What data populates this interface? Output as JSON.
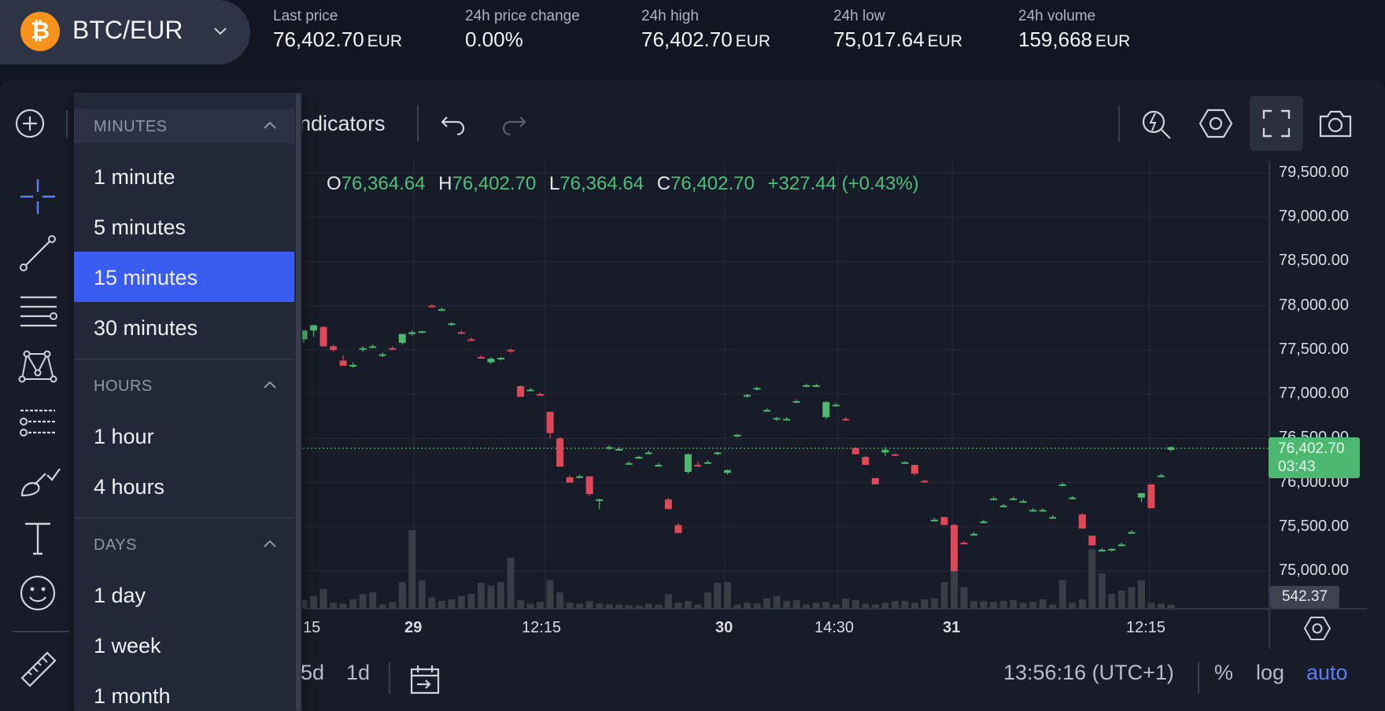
{
  "market": {
    "pair": "BTC/EUR",
    "coin_icon": "bitcoin-icon",
    "currency": "EUR",
    "last_price_label": "Last price",
    "last_price": "76,402.70",
    "change_label": "24h price change",
    "change": "0.00%",
    "high_label": "24h high",
    "high": "76,402.70",
    "low_label": "24h low",
    "low": "75,017.64",
    "volume_label": "24h volume",
    "volume": "159,668"
  },
  "toolbar": {
    "indicators_label": "ndicators",
    "icons": [
      "plus-circle-icon",
      "undo-icon",
      "redo-icon",
      "quick-search-icon",
      "settings-hex-icon",
      "fullscreen-icon",
      "camera-icon"
    ]
  },
  "left_tools": [
    "crosshair-icon",
    "trend-line-icon",
    "fib-lines-icon",
    "pattern-icon",
    "prediction-icon",
    "brush-icon",
    "text-icon",
    "emoji-icon",
    "ruler-icon"
  ],
  "timeframe_menu": {
    "sections": [
      {
        "title": "MINUTES",
        "items": [
          "1 minute",
          "5 minutes",
          "15 minutes",
          "30 minutes"
        ]
      },
      {
        "title": "HOURS",
        "items": [
          "1 hour",
          "4 hours"
        ]
      },
      {
        "title": "DAYS",
        "items": [
          "1 day",
          "1 week",
          "1 month"
        ]
      }
    ],
    "selected": "15 minutes"
  },
  "ohlc": {
    "o_label": "O",
    "o": "76,364.64",
    "h_label": "H",
    "h": "76,402.70",
    "l_label": "L",
    "l": "76,364.64",
    "c_label": "C",
    "c": "76,402.70",
    "change": "+327.44 (+0.43%)"
  },
  "chart_data": {
    "type": "candlestick",
    "y_ticks": [
      "79,500.00",
      "79,000.00",
      "78,500.00",
      "78,000.00",
      "77,500.00",
      "77,000.00",
      "76,500.00",
      "76,000.00",
      "75,500.00",
      "75,000.00"
    ],
    "ylim": [
      74600,
      79700
    ],
    "x_ticks": [
      {
        "label": "15",
        "bold": false
      },
      {
        "label": "29",
        "bold": true
      },
      {
        "label": "12:15",
        "bold": false
      },
      {
        "label": "30",
        "bold": true
      },
      {
        "label": "14:30",
        "bold": false
      },
      {
        "label": "31",
        "bold": true
      },
      {
        "label": "12:15",
        "bold": false
      }
    ],
    "current_price": "76,402.70",
    "countdown": "03:43",
    "current_price_value": 76402.7,
    "volume_readout": "542.37",
    "candles": [
      [
        77620,
        77720,
        77580,
        77720,
        0.9
      ],
      [
        77720,
        77780,
        77650,
        77780,
        1.4
      ],
      [
        77760,
        77760,
        77540,
        77540,
        2.2
      ],
      [
        77540,
        77560,
        77480,
        77500,
        0.6
      ],
      [
        77380,
        77440,
        77320,
        77320,
        0.5
      ],
      [
        77330,
        77360,
        77300,
        77330,
        1.0
      ],
      [
        77520,
        77540,
        77480,
        77520,
        1.6
      ],
      [
        77540,
        77560,
        77520,
        77540,
        1.8
      ],
      [
        77440,
        77470,
        77420,
        77450,
        0.4
      ],
      [
        77520,
        77540,
        77500,
        77510,
        0.7
      ],
      [
        77580,
        77680,
        77560,
        77680,
        3.0
      ],
      [
        77680,
        77720,
        77660,
        77700,
        9.0
      ],
      [
        77700,
        77720,
        77690,
        77710,
        3.2
      ],
      [
        78000,
        78020,
        77980,
        77990,
        1.2
      ],
      [
        77960,
        77980,
        77940,
        77960,
        0.8
      ],
      [
        77790,
        77810,
        77770,
        77800,
        1.0
      ],
      [
        77700,
        77720,
        77680,
        77690,
        1.4
      ],
      [
        77620,
        77640,
        77600,
        77610,
        1.6
      ],
      [
        77420,
        77440,
        77400,
        77410,
        2.9
      ],
      [
        77360,
        77420,
        77340,
        77400,
        2.6
      ],
      [
        77400,
        77420,
        77380,
        77410,
        3.0
      ],
      [
        77500,
        77520,
        77470,
        77490,
        5.8
      ],
      [
        77090,
        77100,
        76970,
        76970,
        0.9
      ],
      [
        77050,
        77070,
        77040,
        77050,
        0.5
      ],
      [
        77000,
        77020,
        76980,
        76990,
        0.7
      ],
      [
        76800,
        76800,
        76500,
        76560,
        3.2
      ],
      [
        76500,
        76520,
        76180,
        76180,
        1.8
      ],
      [
        76060,
        76080,
        76000,
        76000,
        0.6
      ],
      [
        76070,
        76090,
        76050,
        76070,
        0.5
      ],
      [
        76070,
        76070,
        75850,
        75870,
        0.8
      ],
      [
        75800,
        75820,
        75700,
        75810,
        0.5
      ],
      [
        76390,
        76420,
        76370,
        76400,
        0.4
      ],
      [
        76380,
        76400,
        76360,
        76380,
        0.4
      ],
      [
        76220,
        76240,
        76200,
        76220,
        0.3
      ],
      [
        76290,
        76300,
        76270,
        76290,
        0.3
      ],
      [
        76340,
        76360,
        76320,
        76340,
        0.5
      ],
      [
        76200,
        76220,
        76180,
        76200,
        0.4
      ],
      [
        75810,
        75830,
        75700,
        75700,
        1.6
      ],
      [
        75520,
        75540,
        75430,
        75430,
        0.6
      ],
      [
        76120,
        76330,
        76100,
        76320,
        0.8
      ],
      [
        76200,
        76240,
        76170,
        76190,
        0.4
      ],
      [
        76230,
        76250,
        76210,
        76230,
        1.8
      ],
      [
        76330,
        76350,
        76310,
        76340,
        2.9
      ],
      [
        76110,
        76150,
        76090,
        76140,
        3.0
      ],
      [
        76530,
        76550,
        76510,
        76540,
        0.4
      ],
      [
        76980,
        77000,
        76960,
        76990,
        0.6
      ],
      [
        77060,
        77080,
        77040,
        77070,
        0.5
      ],
      [
        76820,
        76840,
        76800,
        76820,
        1.1
      ],
      [
        76720,
        76740,
        76700,
        76730,
        1.4
      ],
      [
        76720,
        76740,
        76700,
        76720,
        0.8
      ],
      [
        76920,
        76940,
        76900,
        76920,
        0.9
      ],
      [
        77100,
        77120,
        77080,
        77100,
        0.4
      ],
      [
        77100,
        77120,
        77080,
        77100,
        0.6
      ],
      [
        76740,
        76920,
        76720,
        76910,
        0.7
      ],
      [
        76880,
        76900,
        76860,
        76880,
        0.4
      ],
      [
        76720,
        76740,
        76700,
        76710,
        1.1
      ],
      [
        76390,
        76400,
        76320,
        76320,
        0.9
      ],
      [
        76290,
        76300,
        76200,
        76200,
        0.5
      ],
      [
        76050,
        76050,
        75980,
        75980,
        0.4
      ],
      [
        76340,
        76400,
        76300,
        76370,
        0.6
      ],
      [
        76320,
        76330,
        76300,
        76310,
        0.8
      ],
      [
        76230,
        76240,
        76220,
        76230,
        0.8
      ],
      [
        76200,
        76200,
        76080,
        76100,
        0.6
      ],
      [
        76020,
        76030,
        76000,
        76010,
        1.0
      ],
      [
        75580,
        75600,
        75560,
        75580,
        1.1
      ],
      [
        75610,
        75610,
        75520,
        75520,
        3.0
      ],
      [
        75520,
        75530,
        74990,
        75000,
        4.4
      ],
      [
        75320,
        75340,
        75300,
        75310,
        2.4
      ],
      [
        75420,
        75440,
        75400,
        75420,
        0.8
      ],
      [
        75560,
        75580,
        75540,
        75560,
        0.8
      ],
      [
        75820,
        75840,
        75800,
        75820,
        0.7
      ],
      [
        75740,
        75760,
        75720,
        75740,
        0.8
      ],
      [
        75820,
        75840,
        75800,
        75820,
        0.9
      ],
      [
        75790,
        75810,
        75770,
        75790,
        0.6
      ],
      [
        75690,
        75710,
        75670,
        75690,
        0.7
      ],
      [
        75690,
        75710,
        75670,
        75690,
        1.0
      ],
      [
        75610,
        75630,
        75590,
        75610,
        0.4
      ],
      [
        75980,
        76000,
        75960,
        75980,
        3.2
      ],
      [
        75830,
        75850,
        75810,
        75830,
        0.6
      ],
      [
        75640,
        75650,
        75480,
        75480,
        1.0
      ],
      [
        75400,
        75400,
        75290,
        75290,
        6.8
      ],
      [
        75240,
        75260,
        75220,
        75240,
        4.0
      ],
      [
        75240,
        75260,
        75220,
        75250,
        1.6
      ],
      [
        75300,
        75320,
        75280,
        75300,
        2.0
      ],
      [
        75440,
        75460,
        75420,
        75440,
        2.4
      ],
      [
        75830,
        75880,
        75780,
        75880,
        3.2
      ],
      [
        75980,
        75980,
        75710,
        75710,
        0.6
      ],
      [
        76080,
        76100,
        76060,
        76080,
        0.5
      ],
      [
        76370,
        76410,
        76350,
        76400,
        0.4
      ]
    ]
  },
  "bottom_bar": {
    "range_5d": "5d",
    "range_1d": "1d",
    "time": "13:56:16 (UTC+1)",
    "percent": "%",
    "log": "log",
    "auto": "auto"
  }
}
